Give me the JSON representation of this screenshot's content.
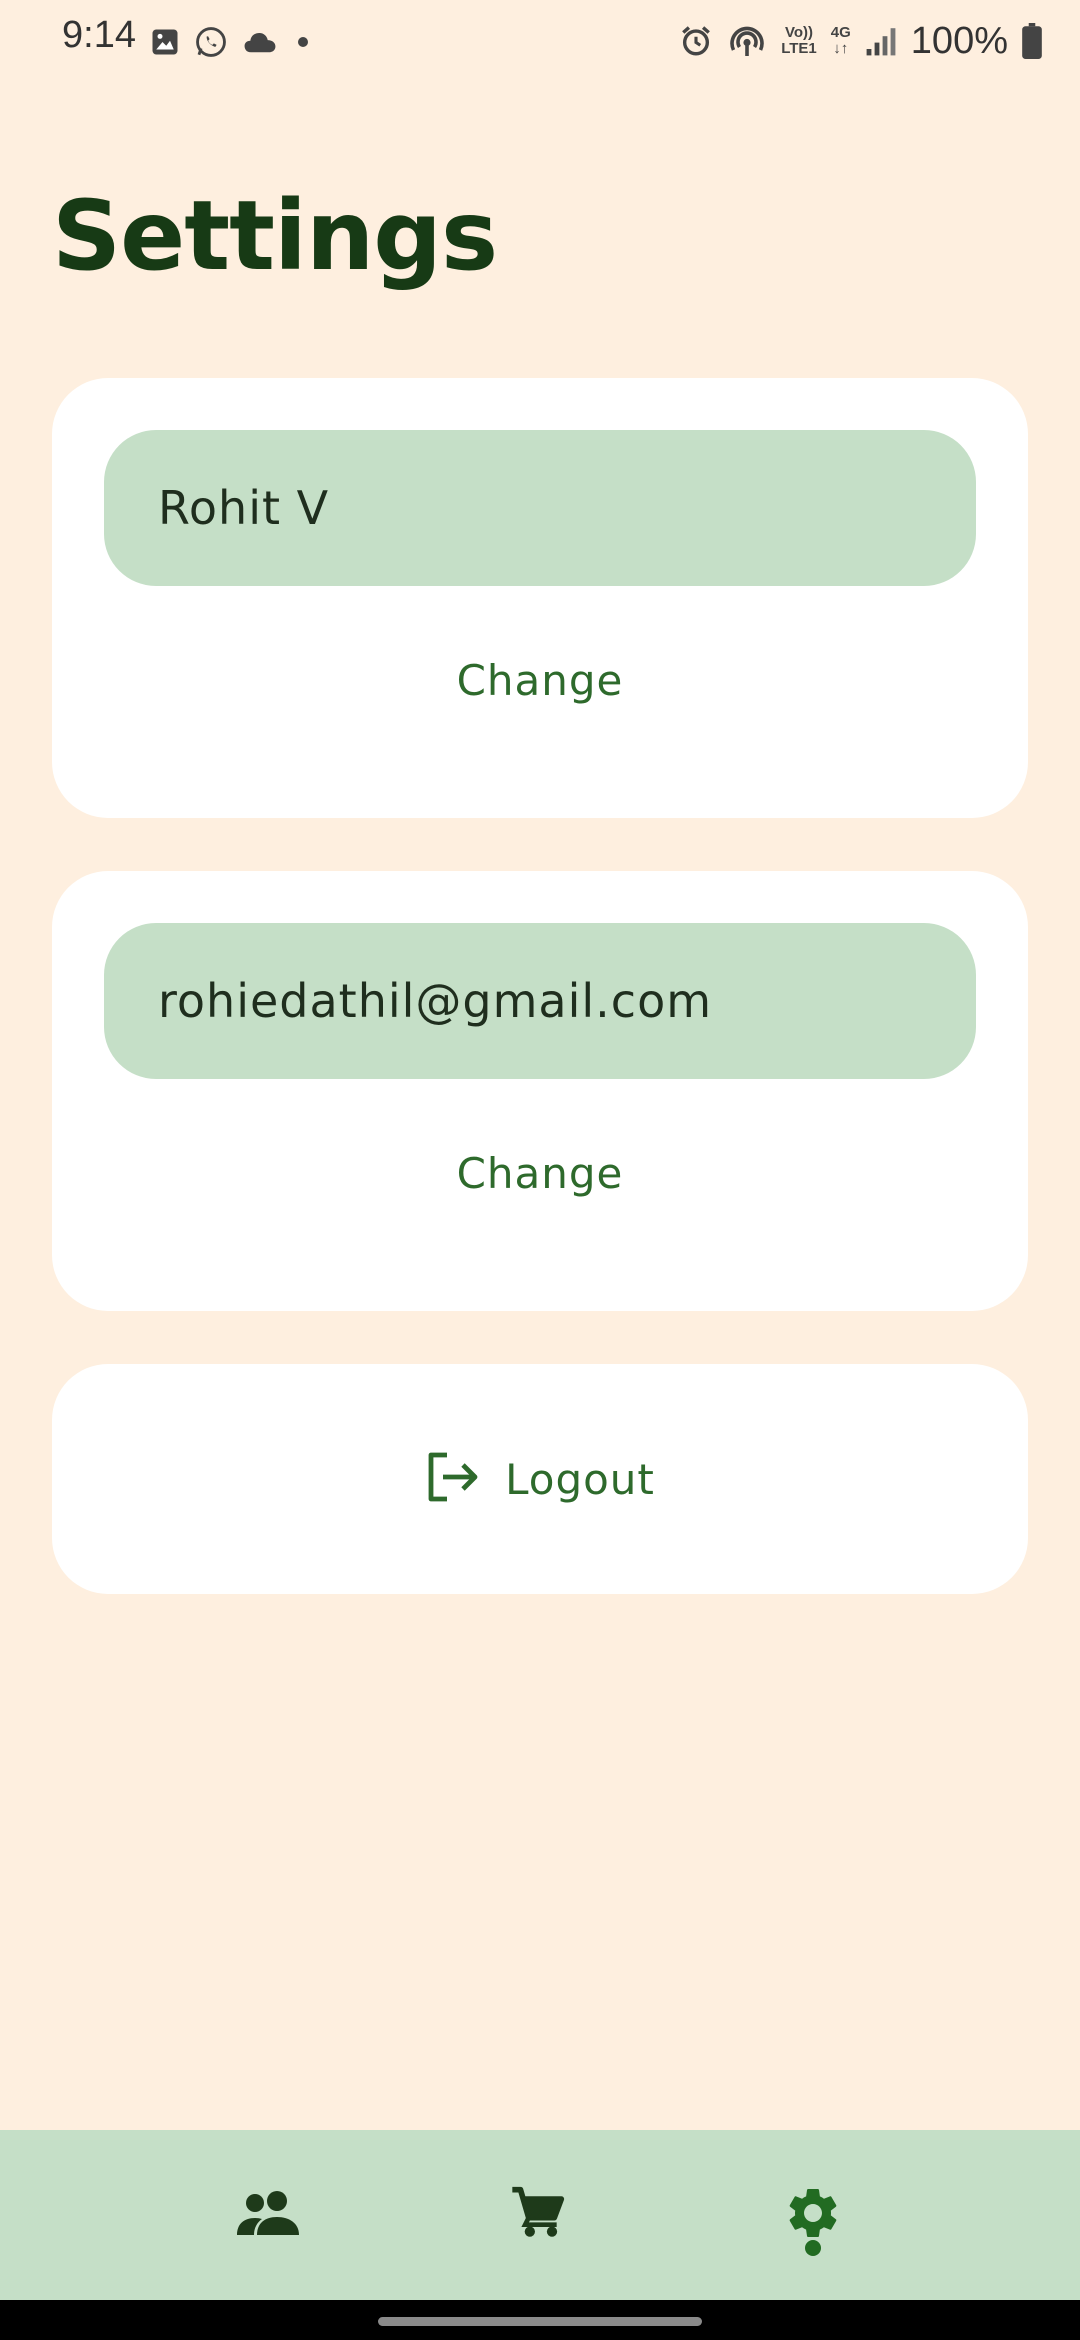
{
  "status_bar": {
    "time": "9:14",
    "left_icons": [
      "image-icon",
      "whatsapp-icon",
      "cloud-icon",
      "dot-icon"
    ],
    "right_icons": [
      "alarm-icon",
      "hotspot-icon",
      "volte-icon",
      "4g-icon",
      "signal-icon",
      "battery-icon"
    ],
    "volte_line1": "Vo))",
    "volte_line2": "LTE1",
    "network_line1": "4G",
    "network_line2": "↓↑",
    "battery": "100%"
  },
  "page": {
    "title": "Settings"
  },
  "name_card": {
    "value": "Rohit V",
    "change_label": "Change"
  },
  "email_card": {
    "value": "rohiedathil@gmail.com",
    "change_label": "Change"
  },
  "logout_card": {
    "label": "Logout",
    "icon": "logout-icon"
  },
  "bottom_nav": {
    "items": [
      {
        "icon": "people-icon",
        "active": false
      },
      {
        "icon": "cart-icon",
        "active": false
      },
      {
        "icon": "gear-icon",
        "active": true
      }
    ]
  },
  "colors": {
    "background": "#FEEFDF",
    "card": "#FFFFFF",
    "field": "#C5DFC7",
    "accent_text": "#2E6A2C",
    "title": "#173A15",
    "nav_bg": "#C5DFC7",
    "nav_icon": "#1E3A1A",
    "nav_active": "#226B22"
  }
}
